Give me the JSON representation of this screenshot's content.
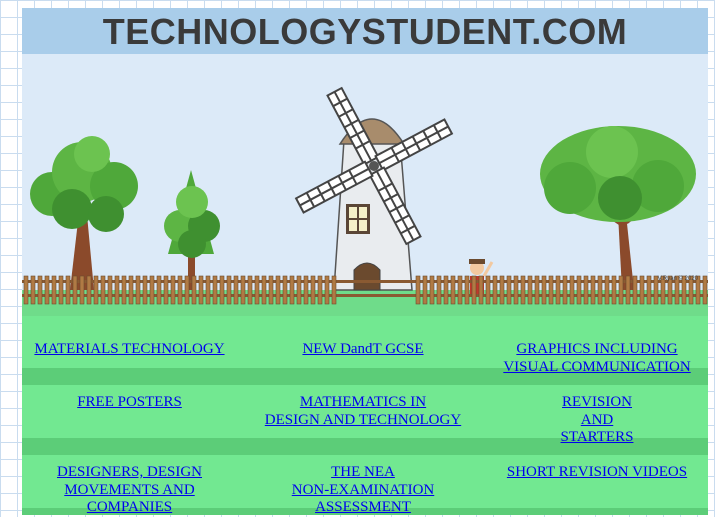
{
  "banner": {
    "title": "TECHNOLOGYSTUDENT.COM",
    "credit": "V.Ryan © 2020"
  },
  "links": [
    [
      "MATERIALS TECHNOLOGY"
    ],
    [
      "NEW DandT GCSE"
    ],
    [
      "GRAPHICS INCLUDING ",
      "VISUAL COMMUNICATION"
    ],
    [
      "FREE POSTERS"
    ],
    [
      "MATHEMATICS IN",
      "DESIGN AND TECHNOLOGY"
    ],
    [
      "REVISION ",
      "AND",
      "STARTERS"
    ],
    [
      "DESIGNERS, DESIGN",
      "MOVEMENTS AND",
      "COMPANIES"
    ],
    [
      "THE NEA",
      "NON-EXAMINATION",
      "ASSESSMENT"
    ],
    [
      "SHORT REVISION VIDEOS"
    ]
  ],
  "colors": {
    "link": "#0000ee",
    "link_panel": "#72e891",
    "link_band": "#5ccd78",
    "banner_header": "#a9cdea",
    "sky": "#dceaf8"
  }
}
